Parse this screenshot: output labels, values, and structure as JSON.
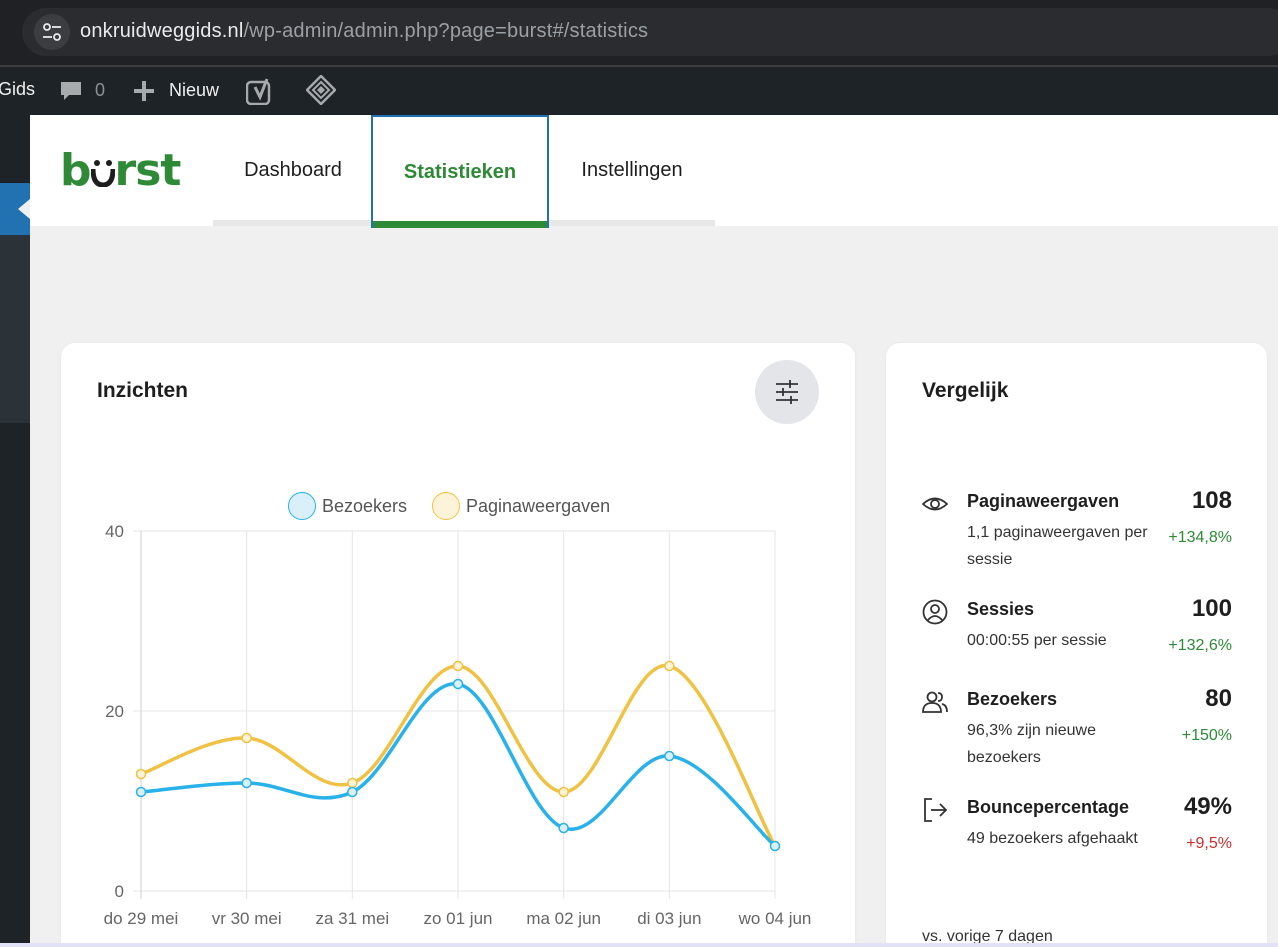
{
  "browser": {
    "url_host": "onkruidweggids.nl",
    "url_path": "/wp-admin/admin.php?page=burst#/statistics"
  },
  "admin_bar": {
    "site_name_partial": "Gids",
    "comments_count": "0",
    "new_label": "Nieuw"
  },
  "app": {
    "logo_text_left": "b",
    "logo_text_right": "rst",
    "tabs": [
      {
        "label": "Dashboard",
        "active": false
      },
      {
        "label": "Statistieken",
        "active": true
      },
      {
        "label": "Instellingen",
        "active": false
      }
    ]
  },
  "insights": {
    "title": "Inzichten"
  },
  "chart_data": {
    "type": "line",
    "categories": [
      "do 29 mei",
      "vr 30 mei",
      "za 31 mei",
      "zo 01 jun",
      "ma 02 jun",
      "di 03 jun",
      "wo 04 jun"
    ],
    "series": [
      {
        "name": "Bezoekers",
        "values": [
          11,
          12,
          11,
          23,
          7,
          15,
          5
        ],
        "color": "#29b1ea",
        "fill": "#d9f0fb"
      },
      {
        "name": "Paginaweergaven",
        "values": [
          13,
          17,
          12,
          25,
          11,
          25,
          5
        ],
        "color": "#f0c243",
        "fill": "#fdf3d9"
      }
    ],
    "yticks": [
      "0",
      "20",
      "40"
    ],
    "ylim": [
      0,
      40
    ],
    "grid": true,
    "legend": "top-center",
    "smooth": true
  },
  "compare": {
    "title": "Vergelijk",
    "rows": [
      {
        "icon": "eye-icon",
        "title": "Paginaweergaven",
        "sub": "1,1 paginaweergaven per sessie",
        "value": "108",
        "change": "+134,8%",
        "trend": "up"
      },
      {
        "icon": "user-circle-icon",
        "title": "Sessies",
        "sub": "00:00:55 per sessie",
        "value": "100",
        "change": "+132,6%",
        "trend": "up"
      },
      {
        "icon": "users-icon",
        "title": "Bezoekers",
        "sub": "96,3% zijn nieuwe bezoekers",
        "value": "80",
        "change": "+150%",
        "trend": "up"
      },
      {
        "icon": "exit-icon",
        "title": "Bouncepercentage",
        "sub": "49 bezoekers afgehaakt",
        "value": "49%",
        "change": "+9,5%",
        "trend": "down"
      }
    ],
    "footer": "vs. vorige 7 dagen"
  }
}
